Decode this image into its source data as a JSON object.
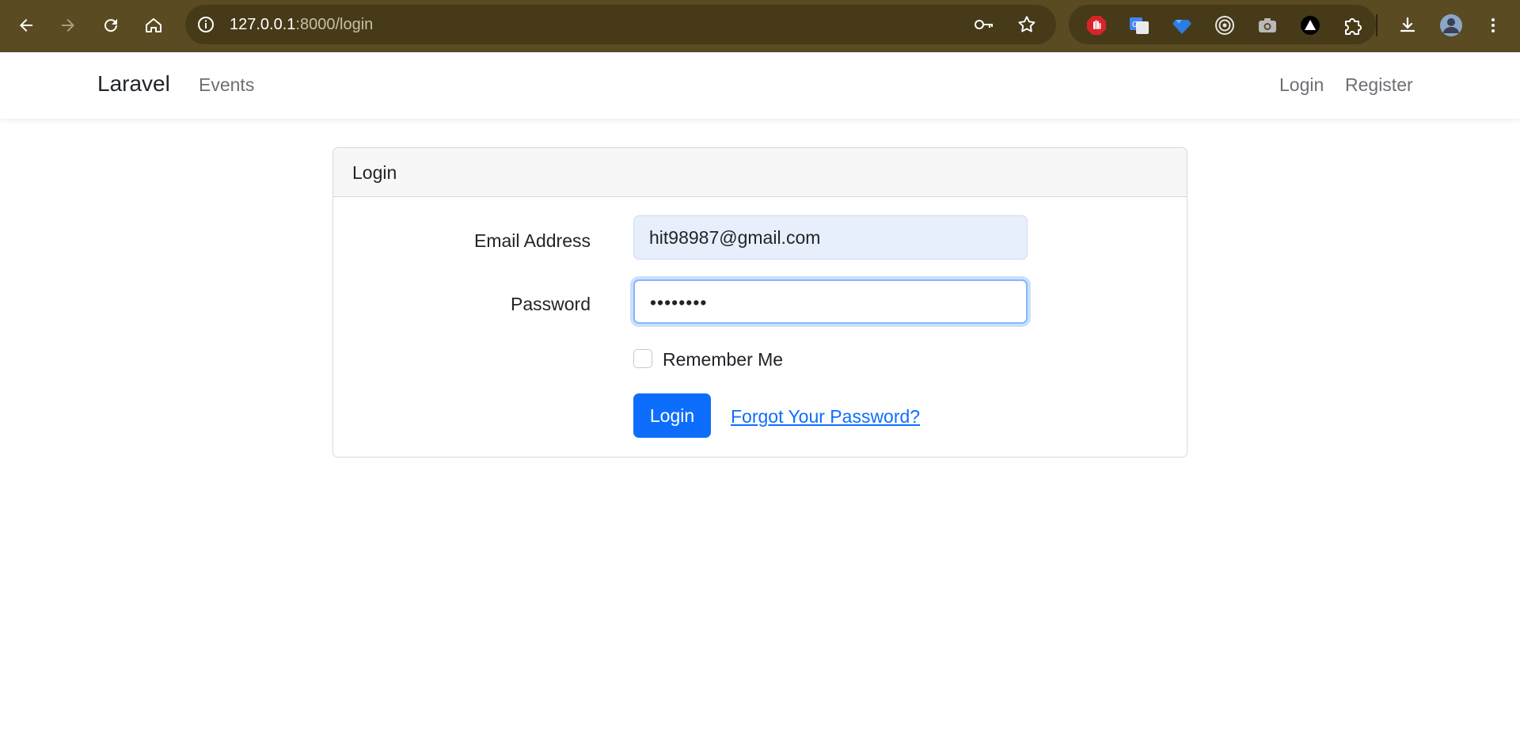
{
  "browser": {
    "url_host": "127.0.0.1",
    "url_path": ":8000/login",
    "icons": [
      "back-arrow-icon",
      "forward-arrow-icon",
      "reload-icon",
      "home-icon",
      "site-info-icon",
      "password-key-icon",
      "bookmark-star-icon",
      "extension-stop-icon",
      "extension-translate-icon",
      "extension-gem-icon",
      "extension-target-icon",
      "extension-camera-icon",
      "extension-triangle-icon",
      "extensions-puzzle-icon",
      "download-icon",
      "profile-avatar-icon",
      "kebab-menu-icon"
    ],
    "colors": {
      "frame": "#5a4b22",
      "omnibox": "#473a18"
    }
  },
  "navbar": {
    "brand": "Laravel",
    "left_links": [
      "Events"
    ],
    "right_links": [
      "Login",
      "Register"
    ]
  },
  "card": {
    "header": "Login",
    "email_label": "Email Address",
    "email_value": "hit98987@gmail.com",
    "password_label": "Password",
    "password_value": "••••••••",
    "remember_label": "Remember Me",
    "remember_checked": false,
    "submit_label": "Login",
    "forgot_link": "Forgot Your Password?"
  },
  "colors": {
    "primary": "#0d6efd",
    "focus_ring": "#86b7fe",
    "autofill_bg": "#e8effc"
  }
}
